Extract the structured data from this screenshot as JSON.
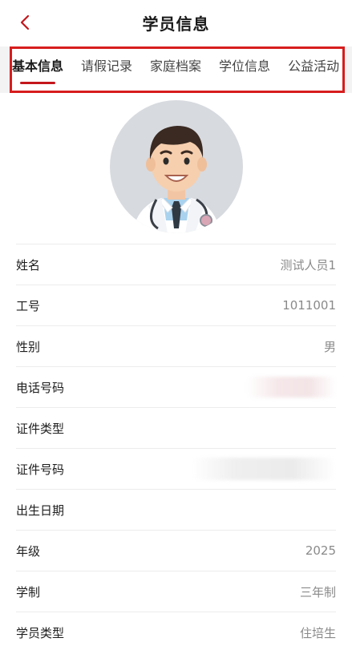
{
  "header": {
    "title": "学员信息",
    "back_icon": "chevron-left-icon",
    "accent": "#c4161c"
  },
  "tabs": [
    {
      "label": "基本信息",
      "active": true
    },
    {
      "label": "请假记录",
      "active": false
    },
    {
      "label": "家庭档案",
      "active": false
    },
    {
      "label": "学位信息",
      "active": false
    },
    {
      "label": "公益活动",
      "active": false
    }
  ],
  "profile": {
    "avatar_icon": "doctor-avatar"
  },
  "fields": [
    {
      "label": "姓名",
      "value": "测试人员1"
    },
    {
      "label": "工号",
      "value": "1011001"
    },
    {
      "label": "性别",
      "value": "男"
    },
    {
      "label": "电话号码",
      "value": ""
    },
    {
      "label": "证件类型",
      "value": ""
    },
    {
      "label": "证件号码",
      "value": ""
    },
    {
      "label": "出生日期",
      "value": ""
    },
    {
      "label": "年级",
      "value": "2025"
    },
    {
      "label": "学制",
      "value": "三年制"
    },
    {
      "label": "学员类型",
      "value": "住培生"
    }
  ]
}
